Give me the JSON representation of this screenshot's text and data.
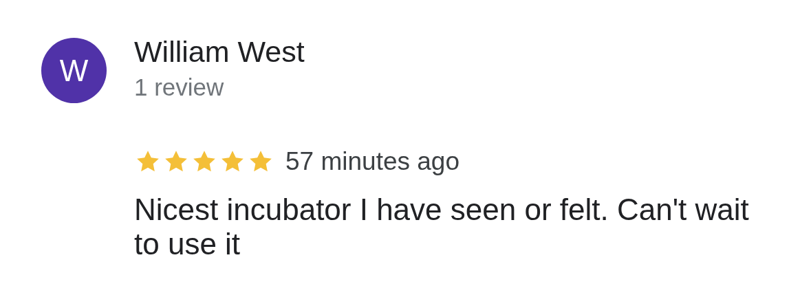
{
  "reviewer": {
    "initial": "W",
    "name": "William West",
    "review_count": "1 review"
  },
  "review": {
    "stars": 5,
    "time": "57 minutes ago",
    "text": "Nicest incubator I have seen or felt. Can't wait to use it"
  }
}
